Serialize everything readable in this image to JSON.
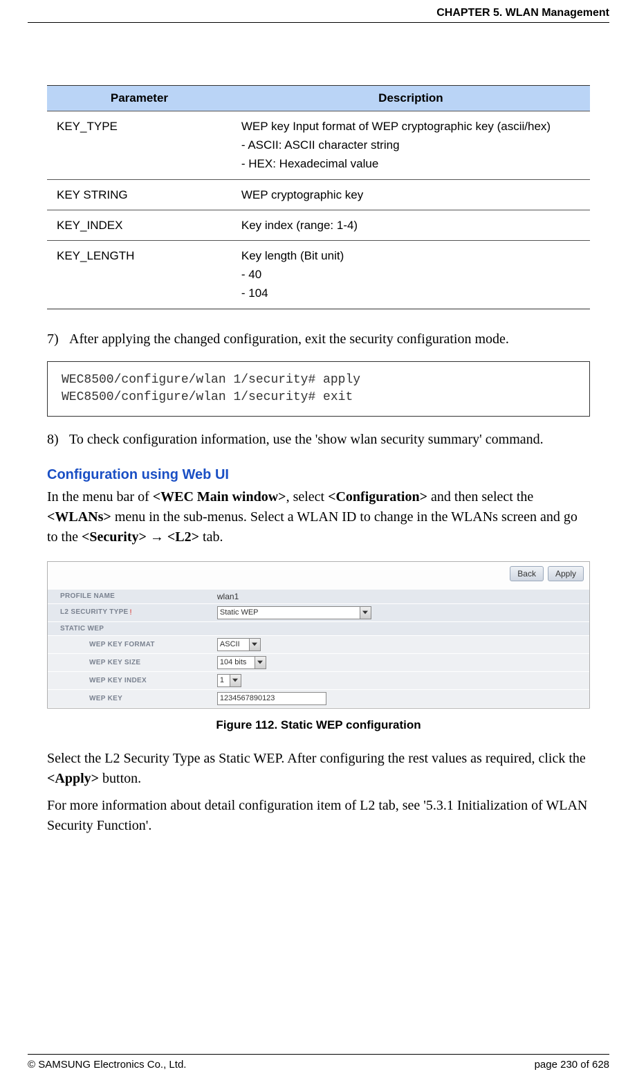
{
  "header": {
    "chapter": "CHAPTER 5. WLAN Management"
  },
  "table": {
    "headers": [
      "Parameter",
      "Description"
    ],
    "rows": [
      {
        "param": "KEY_TYPE",
        "desc": "WEP key Input format of WEP cryptographic key (ascii/hex)\n- ASCII: ASCII character string\n- HEX: Hexadecimal value"
      },
      {
        "param": "KEY STRING",
        "desc": "WEP cryptographic key"
      },
      {
        "param": "KEY_INDEX",
        "desc": "Key index (range: 1-4)"
      },
      {
        "param": "KEY_LENGTH",
        "desc": "Key length (Bit unit)\n- 40\n- 104"
      }
    ]
  },
  "steps": {
    "s7": {
      "num": "7)",
      "text": "After applying the changed configuration, exit the security configuration mode."
    },
    "code7": "WEC8500/configure/wlan 1/security# apply\nWEC8500/configure/wlan 1/security# exit",
    "s8": {
      "num": "8)",
      "text": "To check configuration information, use the 'show wlan security summary' command."
    }
  },
  "section": {
    "heading": "Configuration using Web UI",
    "intro_pre": "In the menu bar of ",
    "intro_b1": "<WEC Main window>",
    "intro_mid1": ", select ",
    "intro_b2": "<Configuration>",
    "intro_mid2": " and then select the ",
    "intro_b3": "<WLANs>",
    "intro_mid3": " menu in the sub-menus. Select a WLAN ID to change in the WLANs screen and go to the ",
    "intro_b4": "<Security>",
    "intro_arrow": " → ",
    "intro_b5": "<L2>",
    "intro_end": " tab."
  },
  "figure": {
    "buttons": {
      "back": "Back",
      "apply": "Apply"
    },
    "rows": {
      "profile_name": {
        "label": "PROFILE NAME",
        "value": "wlan1"
      },
      "l2_type": {
        "label": "L2 SECURITY TYPE",
        "req": "!",
        "value": "Static WEP"
      },
      "group": {
        "label": "STATIC WEP"
      },
      "wep_format": {
        "label": "WEP KEY FORMAT",
        "value": "ASCII"
      },
      "wep_size": {
        "label": "WEP KEY SIZE",
        "value": "104 bits"
      },
      "wep_index": {
        "label": "WEP KEY INDEX",
        "value": "1"
      },
      "wep_key": {
        "label": "WEP KEY",
        "value": "1234567890123"
      }
    },
    "caption": "Figure 112. Static WEP configuration"
  },
  "trailing": {
    "p1_pre": "Select the L2 Security Type as Static WEP. After configuring the rest values as required, click the ",
    "p1_b": "<Apply>",
    "p1_post": " button.",
    "p2": "For more information about detail configuration item of L2 tab, see '5.3.1 Initialization of WLAN Security Function'."
  },
  "footer": {
    "left": "© SAMSUNG Electronics Co., Ltd.",
    "right": "page 230 of 628"
  }
}
